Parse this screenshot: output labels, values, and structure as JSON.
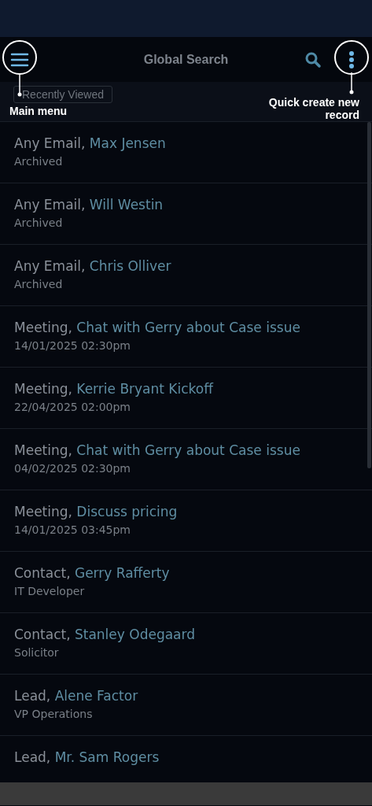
{
  "header": {
    "title": "Global Search"
  },
  "filter_button": {
    "label": "Recently Viewed"
  },
  "annotations": [
    {
      "label": "Main menu",
      "kind": "left"
    },
    {
      "label": "Quick create new record",
      "kind": "right"
    }
  ],
  "results": [
    {
      "type": "Any Email,",
      "name": "Max Jensen",
      "detail": "Archived"
    },
    {
      "type": "Any Email,",
      "name": "Will Westin",
      "detail": "Archived"
    },
    {
      "type": "Any Email,",
      "name": "Chris Olliver",
      "detail": "Archived"
    },
    {
      "type": "Meeting,",
      "name": "Chat with Gerry about Case issue",
      "detail": "14/01/2025 02:30pm"
    },
    {
      "type": "Meeting,",
      "name": "Kerrie Bryant Kickoff",
      "detail": "22/04/2025 02:00pm"
    },
    {
      "type": "Meeting,",
      "name": "Chat with Gerry about Case issue",
      "detail": "04/02/2025 02:30pm"
    },
    {
      "type": "Meeting,",
      "name": "Discuss pricing",
      "detail": "14/01/2025 03:45pm"
    },
    {
      "type": "Contact,",
      "name": "Gerry Rafferty",
      "detail": "IT Developer"
    },
    {
      "type": "Contact,",
      "name": "Stanley Odegaard",
      "detail": "Solicitor"
    },
    {
      "type": "Lead,",
      "name": "Alene Factor",
      "detail": "VP Operations"
    },
    {
      "type": "Lead,",
      "name": "Mr. Sam Rogers"
    }
  ]
}
